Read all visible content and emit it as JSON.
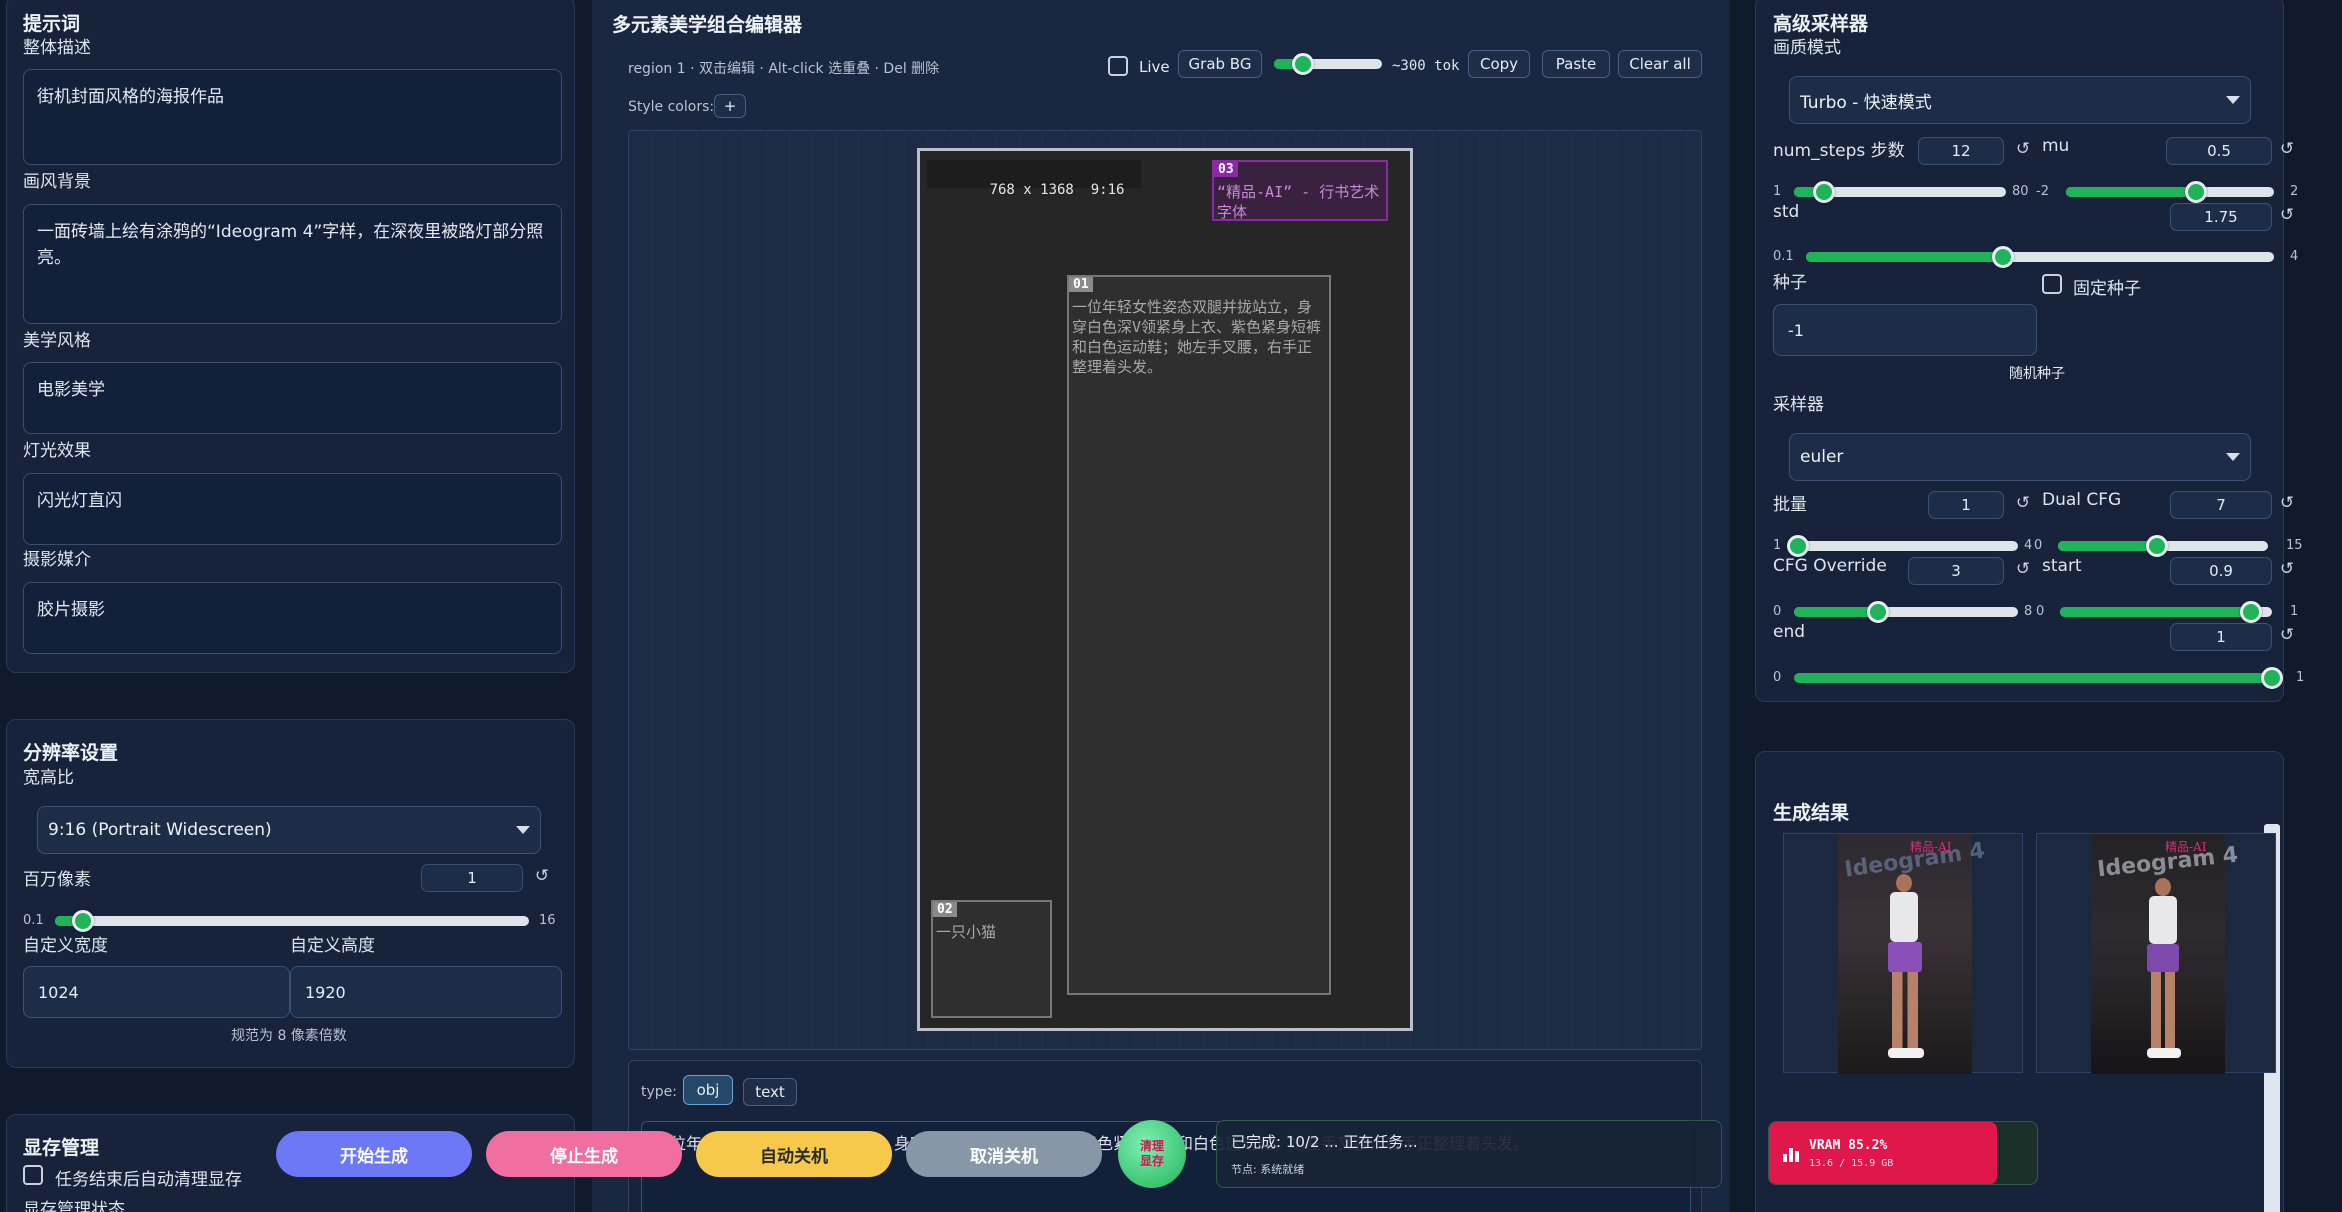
{
  "prompt": {
    "title": "提示词",
    "overall_label": "整体描述",
    "overall_value": "街机封面风格的海报作品",
    "background_label": "画风背景",
    "background_value": "一面砖墙上绘有涂鸦的“Ideogram 4”字样，在深夜里被路灯部分照亮。",
    "style_label": "美学风格",
    "style_value": "电影美学",
    "light_label": "灯光效果",
    "light_value": "闪光灯直闪",
    "media_label": "摄影媒介",
    "media_value": "胶片摄影"
  },
  "resolution": {
    "title": "分辨率设置",
    "aspect_label": "宽高比",
    "aspect_value": "9:16 (Portrait Widescreen)",
    "mp_label": "百万像素",
    "mp_value": "1",
    "mp_min": "0.1",
    "mp_max": "16",
    "mp_level": 0.06,
    "width_label": "自定义宽度",
    "width_value": "1024",
    "height_label": "自定义高度",
    "height_value": "1920",
    "note": "规范为 8 像素倍数"
  },
  "vram_mgmt": {
    "title": "显存管理",
    "auto_clear_label": "任务结束后自动清理显存",
    "status_label": "显存管理状态"
  },
  "editor": {
    "title": "多元素美学组合编辑器",
    "hint": "region 1 · 双击编辑 · Alt-click 选重叠 · Del 删除",
    "live_label": "Live",
    "grab_bg": "Grab BG",
    "tok": "~300 tok",
    "copy": "Copy",
    "paste": "Paste",
    "clear_all": "Clear all",
    "style_colors": "Style colors:",
    "add_color": "+",
    "canvas_size": "768 x 1368",
    "canvas_ratio": "9:16",
    "regions": [
      {
        "tag": "01",
        "text": "一位年轻女性姿态双腿并拢站立，身穿白色深V领紧身上衣、紫色紧身短裤和白色运动鞋；她左手叉腰，右手正整理着头发。"
      },
      {
        "tag": "02",
        "text": "一只小猫"
      },
      {
        "tag": "03",
        "text": "“精品-AI” - 行书艺术字体"
      }
    ],
    "type_label": "type:",
    "type_obj": "obj",
    "type_text": "text",
    "region_text": "一位年轻女性姿态双腿并拢站立，身穿白色深V领紧身上衣、紫色紧身短裤和白色运动鞋；她左手叉腰，右手正整理着头发。"
  },
  "sampler": {
    "title": "高级采样器",
    "mode_label": "画质模式",
    "mode_value": "Turbo - 快速模式",
    "steps_label": "num_steps 步数",
    "steps_value": "12",
    "steps_min": "1",
    "steps_max": "80",
    "steps_level": 0.14,
    "mu_label": "mu",
    "mu_value": "0.5",
    "mu_min": "-2",
    "mu_max": "2",
    "mu_level": 0.625,
    "std_label": "std",
    "std_value": "1.75",
    "std_min": "0.1",
    "std_max": "4",
    "std_level": 0.42,
    "seed_label": "种子",
    "seed_value": "-1",
    "fixed_seed_label": "固定种子",
    "random_seed": "随机种子",
    "sampler_label": "采样器",
    "sampler_value": "euler",
    "batch_label": "批量",
    "batch_value": "1",
    "batch_min": "1",
    "batch_max": "4",
    "batch_level": 0.0,
    "dualcfg_label": "Dual CFG",
    "dualcfg_value": "7",
    "dualcfg_min": "0",
    "dualcfg_max": "15",
    "dualcfg_level": 0.47,
    "cfgo_label": "CFG Override",
    "cfgo_value": "3",
    "cfgo_min": "0",
    "cfgo_max": "8",
    "cfgo_level": 0.375,
    "start_label": "start",
    "start_value": "0.9",
    "start_min": "0",
    "start_max": "1",
    "start_level": 0.9,
    "end_label": "end",
    "end_value": "1",
    "end_min": "0",
    "end_max": "1",
    "end_level": 1.0
  },
  "results": {
    "title": "生成结果",
    "poster_text": "精品-AI",
    "wall_text": "Ideogram 4"
  },
  "actions": {
    "start": "开始生成",
    "stop": "停止生成",
    "auto_shutdown": "自动关机",
    "cancel_shutdown": "取消关机",
    "clear_vram": "清理显存"
  },
  "status": {
    "line1": "已完成: 10/2 ... 正在任务...",
    "line2": "节点: 系统就绪"
  },
  "vram": {
    "label": "VRAM 85.2%",
    "detail": "13.6 / 15.9 GB",
    "level": 0.852
  },
  "colors": {
    "accent": "#1fb35a",
    "start_btn": "#6c78f5",
    "stop_btn": "#f06fa0",
    "auto_btn": "#f6c94a",
    "cancel_btn": "#8797a8",
    "vram_bar": "#e0174a",
    "region3": "#8a2aa8"
  }
}
